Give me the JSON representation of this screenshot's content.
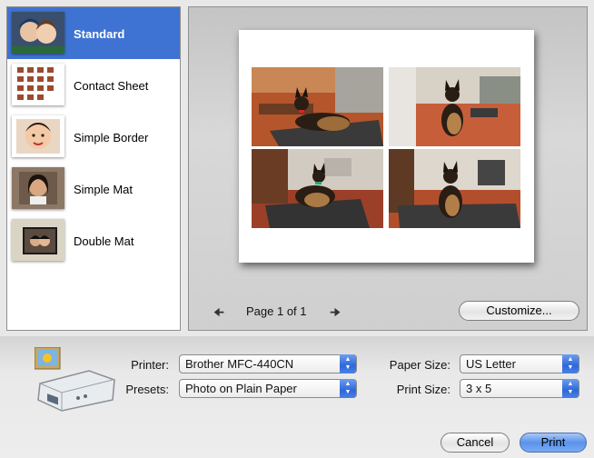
{
  "templates": [
    {
      "label": "Standard",
      "selected": true,
      "thumb": "two-people-photo"
    },
    {
      "label": "Contact Sheet",
      "selected": false,
      "thumb": "contact-sheet-grid"
    },
    {
      "label": "Simple Border",
      "selected": false,
      "thumb": "baby-photo"
    },
    {
      "label": "Simple Mat",
      "selected": false,
      "thumb": "girl-photo"
    },
    {
      "label": "Double Mat",
      "selected": false,
      "thumb": "couple-photo"
    }
  ],
  "preview": {
    "photos": [
      "dog-on-mat",
      "dog-sitting-porch",
      "dog-lying-mat",
      "dog-sitting-mat"
    ],
    "page_label": "Page 1 of 1",
    "prev_icon": "left-arrow-icon",
    "next_icon": "right-arrow-icon",
    "customize_label": "Customize..."
  },
  "settings": {
    "printer_label": "Printer:",
    "printer_value": "Brother MFC-440CN",
    "presets_label": "Presets:",
    "presets_value": "Photo on Plain Paper",
    "paper_size_label": "Paper Size:",
    "paper_size_value": "US Letter",
    "print_size_label": "Print Size:",
    "print_size_value": "3 x 5",
    "printer_icon": "printer-icon"
  },
  "actions": {
    "cancel_label": "Cancel",
    "print_label": "Print"
  },
  "colors": {
    "selection": "#3f73d3",
    "stepper": "#2e68d8"
  }
}
